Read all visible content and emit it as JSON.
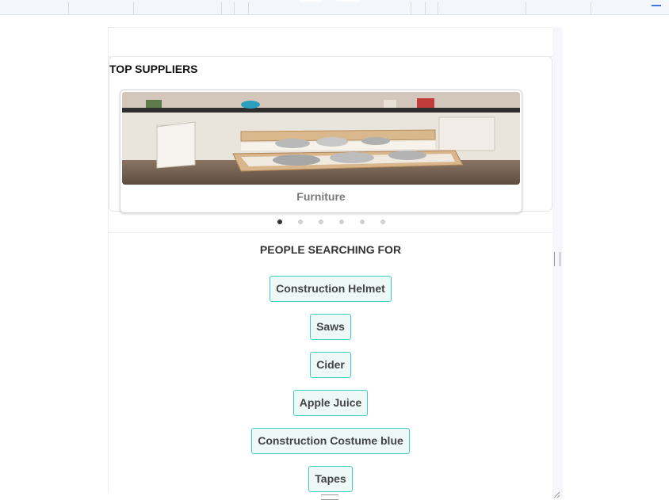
{
  "suppliers": {
    "title": "TOP SUPPLIERS",
    "card_label": "Furniture",
    "carousel_dots": 6,
    "active_dot": 1
  },
  "searching": {
    "title": "PEOPLE SEARCHING FOR",
    "tags": [
      "Construction Helmet",
      "Saws",
      "Cider",
      "Apple Juice",
      "Construction Costume blue",
      "Tapes"
    ]
  },
  "colors": {
    "tag_border": "#39d2c0",
    "tag_bg": "#eef8f7"
  }
}
